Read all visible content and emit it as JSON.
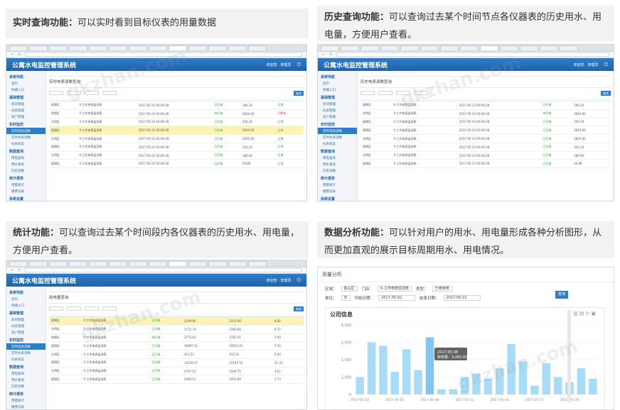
{
  "captions": {
    "realtime": {
      "bold": "实时查询功能：",
      "text": "可以实时看到目标仪表的用量数据"
    },
    "history": {
      "bold": "历史查询功能：",
      "text": "可以查询过去某个时间节点各仪器表的历史用水、用电量，方便用户查看。"
    },
    "stats": {
      "bold": "统计功能：",
      "text": "可以查询过去某个时间段内各仪器表的历史用水、用电量，方便用户查看。"
    },
    "analysis": {
      "bold": "数据分析功能：",
      "text": "可以针对用户的用水、用电量形成各种分析图形，从而更加直观的展示目标周期用水、用电情况。"
    }
  },
  "app": {
    "title": "公寓水电监控管理系统",
    "user": "欢迎您 · 管理员",
    "power_icon": "power-icon"
  },
  "panel_realtime": {
    "page_title": "实时电表读数查询",
    "rows": [
      {
        "area": "理想区",
        "name": "0-工作电表监测表",
        "time": "2017-05-23 00:00:28",
        "status": "已开电",
        "value": "180.24",
        "state": "正常",
        "bad": false,
        "hl": false
      },
      {
        "area": "理想区",
        "name": "0-工作电表监测表",
        "time": "2017-05-23 00:00:28",
        "status": "待开电",
        "value": "2810.00",
        "state": "已断电",
        "bad": true,
        "hl": false
      },
      {
        "area": "光明区",
        "name": "0-工作电表监测表",
        "time": "2017-05-23 00:00:28",
        "status": "已开电",
        "value": "250.34",
        "state": "正常",
        "bad": false,
        "hl": false
      },
      {
        "area": "理想区",
        "name": "0-工作电表监测表",
        "time": "2017-05-23 00:00:28",
        "status": "已开电",
        "value": "2810.00",
        "state": "正常",
        "bad": false,
        "hl": true
      },
      {
        "area": "光明区",
        "name": "0-工作电表监测表",
        "time": "2017-05-23 00:00:28",
        "status": "已开电",
        "value": "2810.00",
        "state": "正常",
        "bad": false,
        "hl": false
      },
      {
        "area": "理想区",
        "name": "0-工作电表监测表",
        "time": "2017-05-23 00:00:28",
        "status": "已开电",
        "value": "341.24",
        "state": "正常",
        "bad": false,
        "hl": false
      },
      {
        "area": "光明区",
        "name": "0-工作电表监测表",
        "time": "2017-05-23 00:00:28",
        "status": "已开电",
        "value": "180.94",
        "state": "正常",
        "bad": false,
        "hl": false
      },
      {
        "area": "理想区",
        "name": "0-工作电表监测表",
        "time": "2017-05-23 00:00:28",
        "status": "已开电",
        "value": "20.86",
        "state": "正常",
        "bad": false,
        "hl": false
      }
    ]
  },
  "panel_history": {
    "page_title": "历史电表读数查询",
    "date": "2017-05-22",
    "rows": [
      {
        "area": "理想区",
        "name": "0-工作电表监测表",
        "time": "2017-05-23 00:00:28",
        "status": "已开电",
        "value": "180.24"
      },
      {
        "area": "光明区",
        "name": "0-工作电表监测表",
        "time": "2017-05-23 00:00:28",
        "status": "待开电",
        "value": "2810.00"
      },
      {
        "area": "理想区",
        "name": "0-工作电表监测表",
        "time": "2017-05-23 00:00:28",
        "status": "已开电",
        "value": "250.34"
      },
      {
        "area": "理想区",
        "name": "0-工作电表监测表",
        "time": "2017-05-23 00:00:28",
        "status": "已开电",
        "value": "2810.00"
      },
      {
        "area": "光明区",
        "name": "0-工作电表监测表",
        "time": "2017-05-23 00:00:28",
        "status": "已开电",
        "value": "2810.00"
      },
      {
        "area": "理想区",
        "name": "0-工作电表监测表",
        "time": "2017-05-23 00:00:28",
        "status": "已开电",
        "value": "341.24"
      },
      {
        "area": "光明区",
        "name": "0-工作电表监测表",
        "time": "2017-05-23 00:00:28",
        "status": "已开电",
        "value": "180.94"
      },
      {
        "area": "理想区",
        "name": "0-工作电表监测表",
        "time": "2017-05-23 00:00:28",
        "status": "已开电",
        "value": "20.86"
      }
    ]
  },
  "panel_stats": {
    "page_title": "用电量查询",
    "rows": [
      {
        "area": "理想区",
        "name": "0-工作电表监测表",
        "status": "已开电",
        "start": "2299.66",
        "end": "2216.90",
        "use": "8.84",
        "hl": true
      },
      {
        "area": "光明区",
        "name": "0-工作电表监测表",
        "status": "已开电",
        "start": "3772.74",
        "end": "3760.66",
        "use": "6.72",
        "hl": false
      },
      {
        "area": "理想区",
        "name": "0-工作电表监测表",
        "status": "待开电",
        "start": "3775.61",
        "end": "3782.61",
        "use": "7.00",
        "hl": false
      },
      {
        "area": "理想区",
        "name": "0-工作电表监测表",
        "status": "已开电",
        "start": "16897.51",
        "end": "16915.01",
        "use": "7.50",
        "hl": false
      },
      {
        "area": "光明区",
        "name": "0-工作电表监测表",
        "status": "已开电",
        "start": "412.52",
        "end": "412.52",
        "use": "0.00",
        "hl": false
      },
      {
        "area": "理想区",
        "name": "0-工作电表监测表",
        "status": "已开电",
        "start": "13534.47",
        "end": "15147.52",
        "use": "12.35",
        "hl": false
      },
      {
        "area": "光明区",
        "name": "0-工作电表监测表",
        "status": "已开电",
        "start": "2707.13",
        "end": "2340.75",
        "use": "3.62",
        "hl": false
      },
      {
        "area": "理想区",
        "name": "0-工作电表监测表",
        "status": "已开电",
        "start": "2469.12",
        "end": "2453.89",
        "use": "1.73",
        "hl": false
      }
    ]
  },
  "sidebar": {
    "items": [
      {
        "label": "系统导航",
        "grp": true
      },
      {
        "label": "首页",
        "grp": false
      },
      {
        "label": "快捷入口",
        "grp": false
      },
      {
        "label": "基础管理",
        "grp": true
      },
      {
        "label": "房间管理",
        "grp": false
      },
      {
        "label": "仪表管理",
        "grp": false
      },
      {
        "label": "住户管理",
        "grp": false
      },
      {
        "label": "实时监控",
        "grp": true
      },
      {
        "label": "实时电表读数",
        "grp": false,
        "on": true
      },
      {
        "label": "实时水表读数",
        "grp": false
      },
      {
        "label": "仪表状态",
        "grp": false
      },
      {
        "label": "数据查询",
        "grp": true
      },
      {
        "label": "用电查询",
        "grp": false
      },
      {
        "label": "用水查询",
        "grp": false
      },
      {
        "label": "历史读数",
        "grp": false
      },
      {
        "label": "统计报表",
        "grp": true
      },
      {
        "label": "用量统计",
        "grp": false
      },
      {
        "label": "缴费记录",
        "grp": false
      },
      {
        "label": "系统设置",
        "grp": true
      }
    ]
  },
  "analysis": {
    "header": "用量分析",
    "area_label": "区域：",
    "area": "金山区",
    "building_label": "门店：",
    "building": "0-工作电表监测表",
    "type_label": "类型：",
    "type": "已电用电",
    "unit_label": "单位：",
    "unit": "日",
    "start_label": "开始日期：",
    "start": "2017-05-02",
    "end_label": "结束日期：",
    "end": "2017-05-22",
    "query": "查询",
    "chart_title": "公司信息",
    "tooltip_date": "2017-05-08",
    "tooltip_value": "用电量：3,282.00"
  },
  "chart_data": {
    "type": "bar",
    "title": "公司信息",
    "ylim": [
      0,
      4000
    ],
    "yticks": [
      "4,000",
      "3,000",
      "2,000",
      "1,000",
      "0"
    ],
    "xticks": [
      "2017-05-02",
      "2017-05-05",
      "2017-05-08",
      "2017-05-11",
      "2017-05-14",
      "2017-05-17",
      "2017-05-20"
    ],
    "values": [
      1000,
      3000,
      2800,
      1300,
      2600,
      1400,
      3282,
      300,
      300,
      1000,
      1200,
      900,
      1500,
      2900,
      1900,
      500,
      1800,
      1000,
      700,
      1500,
      900
    ]
  },
  "watermark": "gkzhan.com"
}
